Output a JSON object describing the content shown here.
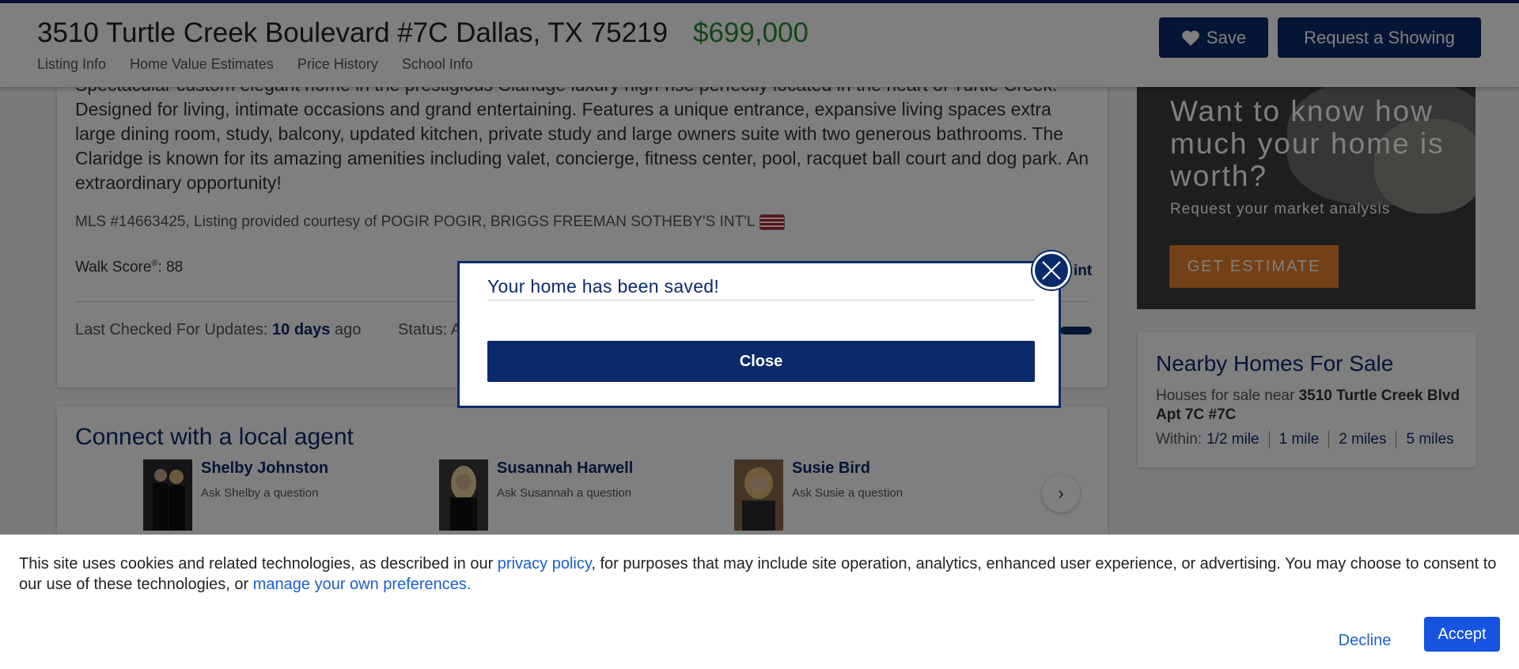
{
  "header": {
    "address": "3510 Turtle Creek Boulevard #7C Dallas, TX 75219",
    "price": "$699,000",
    "nav": [
      "Listing Info",
      "Home Value Estimates",
      "Price History",
      "School Info"
    ],
    "save_label": "Save",
    "showing_label": "Request a Showing"
  },
  "listing": {
    "description": "Spectacular custom elegant home in the prestigious Claridge luxury high-rise perfectly located in the heart of Turtle Creek. Designed for living, intimate occasions and grand entertaining. Features a unique entrance, expansive living spaces extra large dining room, study, balcony, updated kitchen, private study and large owners suite with two generous bathrooms. The Claridge is known for its amazing amenities including valet, concierge, fitness center, pool, racquet ball court and dog park. An extraordinary opportunity!",
    "mls_line": "MLS #14663425, Listing provided courtesy of POGIR POGIR, BRIGGS FREEMAN SOTHEBY'S INT'L",
    "walk_score_label": "Walk Score",
    "walk_score_mark": "®",
    "walk_score_value": ": 88",
    "print_fragment": "int",
    "updates_label": "Last Checked For Updates: ",
    "updates_value": "10 days",
    "updates_suffix": " ago",
    "status_label": "Status: A"
  },
  "agents": {
    "title": "Connect with a local agent",
    "list": [
      {
        "name": "Shelby Johnston",
        "ask": "Ask Shelby a question"
      },
      {
        "name": "Susannah Harwell",
        "ask": "Ask Susannah a question"
      },
      {
        "name": "Susie Bird",
        "ask": "Ask Susie a question"
      }
    ],
    "next_icon": "chevron-right-icon"
  },
  "ad": {
    "headline": "Want to know how much your home is worth?",
    "sub": "Request your market analysis",
    "button": "GET ESTIMATE"
  },
  "nearby": {
    "title": "Nearby Homes For Sale",
    "text_prefix": "Houses for sale near ",
    "text_address": "3510 Turtle Creek Blvd Apt 7C #7C",
    "within_label": "Within:",
    "options": [
      "1/2 mile",
      "1 mile",
      "2 miles",
      "5 miles"
    ]
  },
  "modal": {
    "title": "Your home has been saved!",
    "close_label": "Close",
    "x_icon": "close-icon"
  },
  "cookie": {
    "text_1": "This site uses cookies and related technologies, as described in our ",
    "link_1": "privacy policy",
    "text_2": ", for purposes that may include site operation, analytics, enhanced user experience, or advertising. You may choose to consent to our use of these technologies, or ",
    "link_2": "manage your own preferences.",
    "decline": "Decline",
    "accept": "Accept"
  },
  "colors": {
    "brand_navy": "#0a2a6b",
    "price_green": "#2d8a37",
    "accent_orange": "#e8802a",
    "accept_blue": "#1553e0"
  }
}
